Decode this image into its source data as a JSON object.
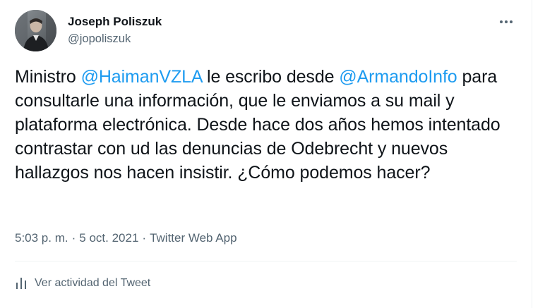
{
  "author": {
    "display_name": "Joseph Poliszuk",
    "handle": "@jopoliszuk"
  },
  "tweet": {
    "text_parts": [
      "Ministro ",
      "@HaimanVZLA",
      " le escribo desde ",
      "@ArmandoInfo",
      " para consultarle una información, que le enviamos a su mail y plataforma electrónica. Desde hace dos años hemos intentado contrastar con ud las denuncias de Odebrecht y nuevos hallazgos nos hacen insistir. ¿Cómo podemos hacer?"
    ],
    "time": "5:03 p. m.",
    "separator": "·",
    "date": "5 oct. 2021",
    "source": "Twitter Web App"
  },
  "actions": {
    "activity_label": "Ver actividad del Tweet"
  },
  "icons": {
    "more": "more-horizontal-icon",
    "activity": "analytics-icon"
  },
  "colors": {
    "link": "#1d9bf0",
    "secondary_text": "#536471",
    "primary_text": "#0f1419",
    "divider": "#eff3f4"
  }
}
